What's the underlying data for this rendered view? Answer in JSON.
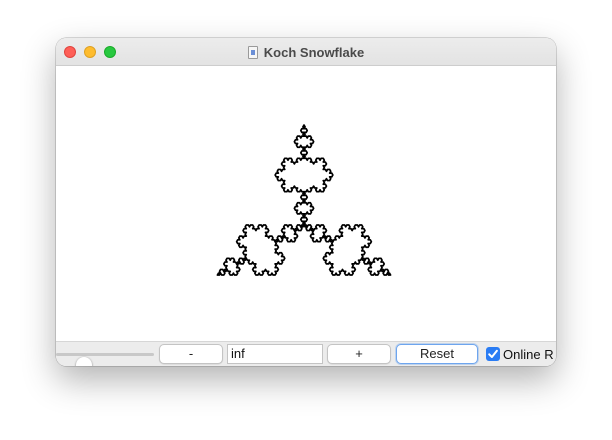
{
  "window": {
    "title": "Koch Snowflake",
    "title_icon": "document-icon"
  },
  "canvas": {
    "figure": "koch-snowflake",
    "stroke_color": "#000000",
    "background": "#ffffff"
  },
  "toolbar": {
    "slider_level": 0.22,
    "minus_label": "-",
    "iterations_value": "inf",
    "plus_label": "+",
    "reset_label": "Reset",
    "checkbox_checked": true,
    "checkbox_label": "Online R"
  },
  "colors": {
    "close": "#fe5f57",
    "minimize": "#febc2e",
    "maximize": "#28c840",
    "accent": "#2a7cf4",
    "focus_ring": "#6ea5ee"
  }
}
